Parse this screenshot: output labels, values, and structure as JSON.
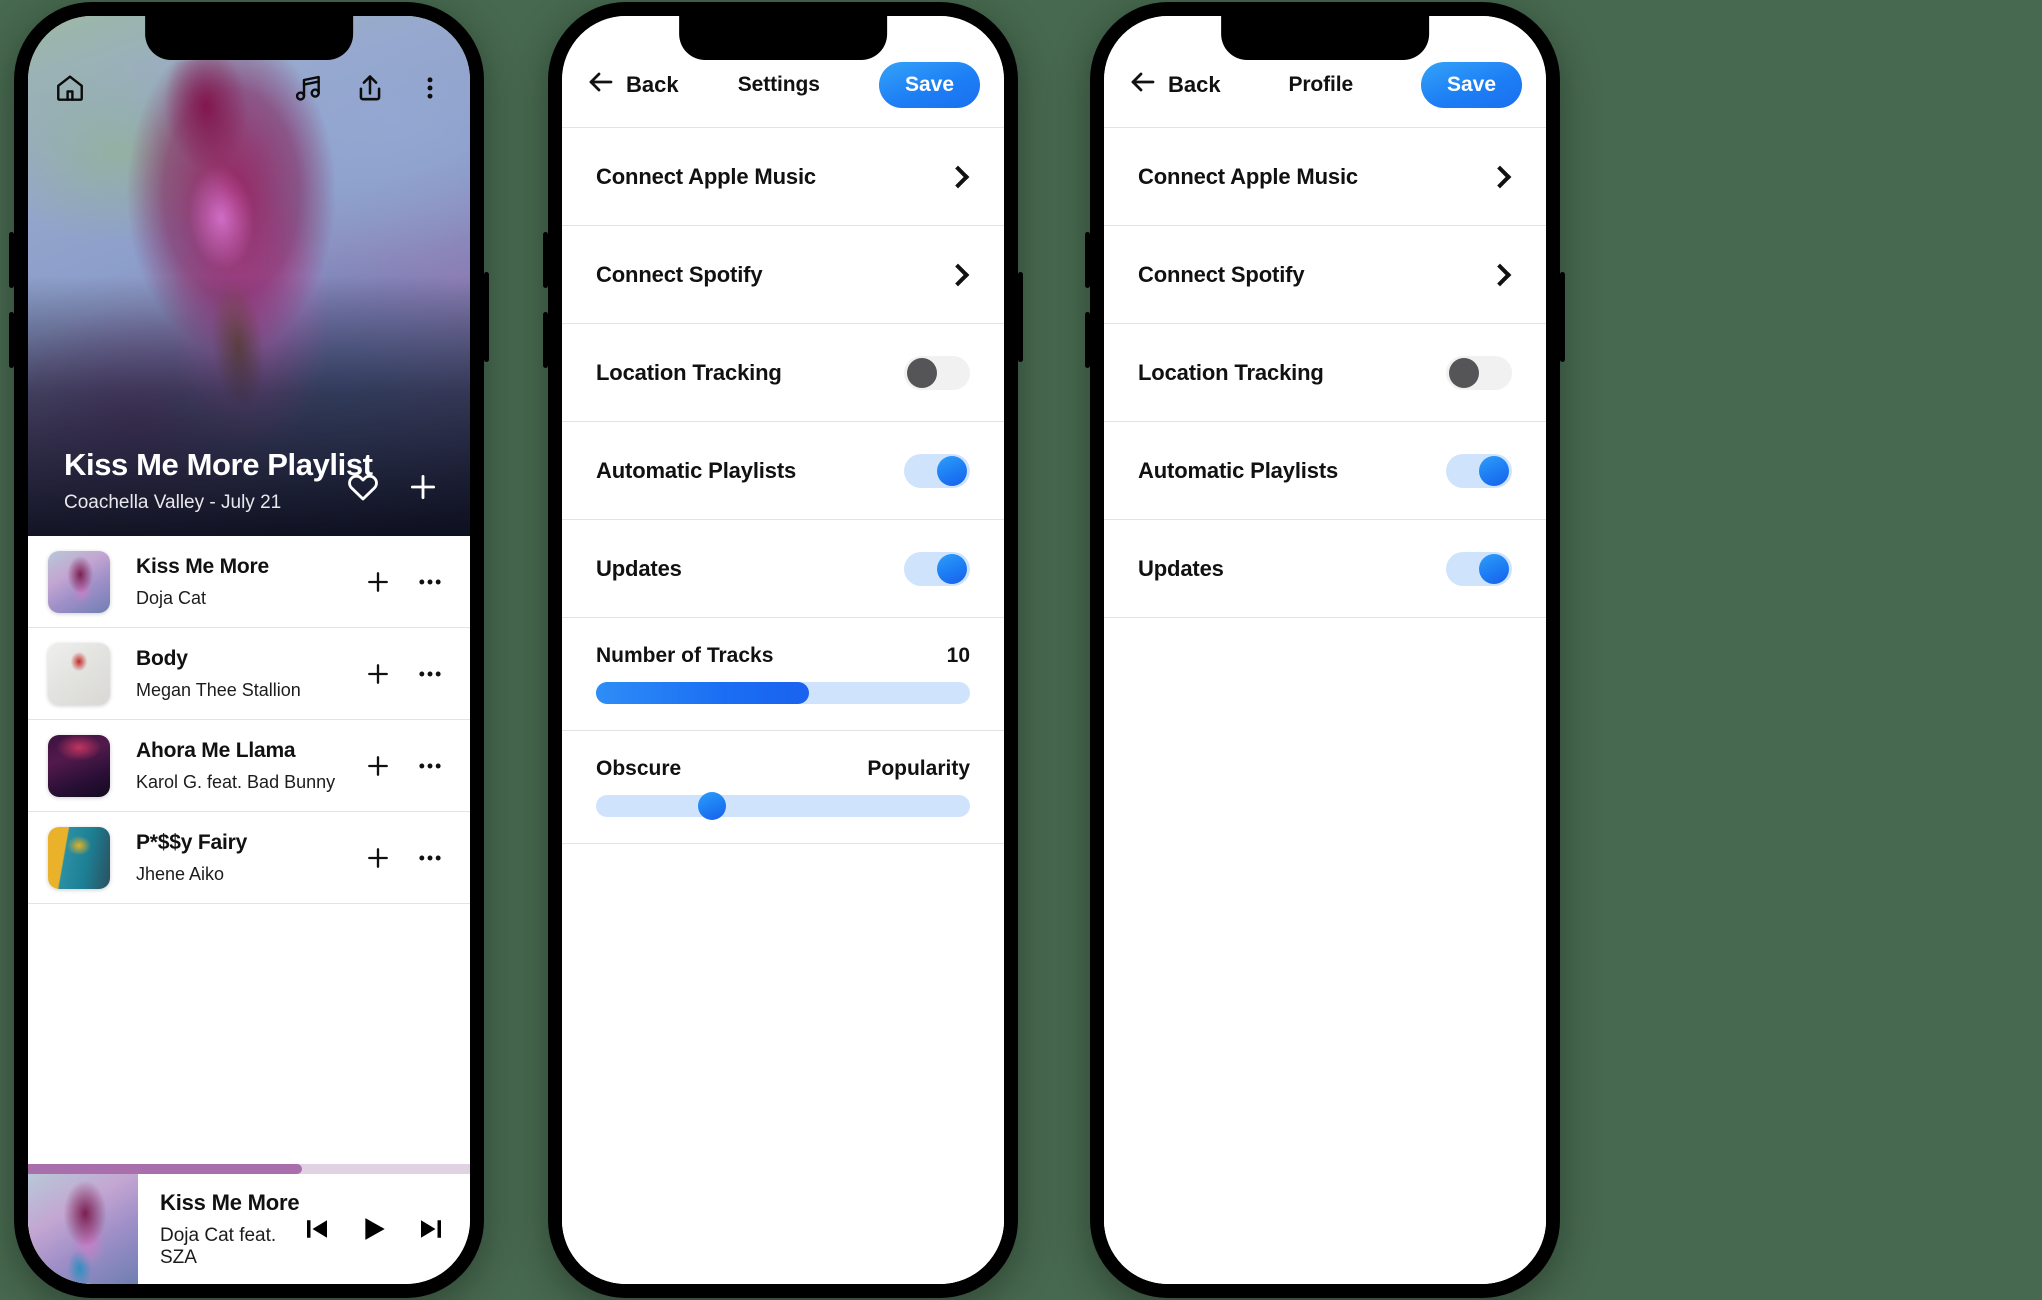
{
  "playlist_screen": {
    "topbar": {
      "home_icon": "home-icon",
      "music_icon": "music-note-icon",
      "share_icon": "share-upload-icon",
      "more_icon": "more-vertical-icon"
    },
    "hero": {
      "title": "Kiss Me More Playlist",
      "subtitle": "Coachella Valley - July 21",
      "like_icon": "heart-icon",
      "add_icon": "plus-icon"
    },
    "tracks": [
      {
        "title": "Kiss Me More",
        "artist": "Doja Cat"
      },
      {
        "title": "Body",
        "artist": "Megan Thee Stallion"
      },
      {
        "title": "Ahora Me Llama",
        "artist": "Karol G. feat. Bad Bunny"
      },
      {
        "title": "P*$$y Fairy",
        "artist": "Jhene Aiko"
      }
    ],
    "row_actions": {
      "add_icon": "plus-icon",
      "more_icon": "more-horizontal-icon"
    },
    "now_playing": {
      "title": "Kiss Me More",
      "artist": "Doja Cat feat. SZA",
      "progress_percent": 62,
      "progress_color": "#a86fac",
      "prev_icon": "skip-previous-icon",
      "play_icon": "play-icon",
      "next_icon": "skip-next-icon"
    }
  },
  "settings_screen": {
    "header": {
      "back_label": "Back",
      "back_icon": "arrow-left-icon",
      "title": "Settings",
      "save_label": "Save",
      "save_color": "#1d7ff5"
    },
    "rows": [
      {
        "label": "Connect Apple Music",
        "control": "chevron"
      },
      {
        "label": "Connect Spotify",
        "control": "chevron"
      },
      {
        "label": "Location Tracking",
        "control": "toggle",
        "value": "off"
      },
      {
        "label": "Automatic Playlists",
        "control": "toggle",
        "value": "on"
      },
      {
        "label": "Updates",
        "control": "toggle",
        "value": "on"
      }
    ],
    "track_slider": {
      "label": "Number of Tracks",
      "value": "10",
      "fill_percent": 57
    },
    "popularity_slider": {
      "left_label": "Obscure",
      "right_label": "Popularity",
      "thumb_percent": 31
    }
  },
  "profile_screen": {
    "header": {
      "back_label": "Back",
      "back_icon": "arrow-left-icon",
      "title": "Profile",
      "save_label": "Save",
      "save_color": "#1d7ff5"
    },
    "rows": [
      {
        "label": "Connect Apple Music",
        "control": "chevron"
      },
      {
        "label": "Connect Spotify",
        "control": "chevron"
      },
      {
        "label": "Location Tracking",
        "control": "toggle",
        "value": "off"
      },
      {
        "label": "Automatic Playlists",
        "control": "toggle",
        "value": "on"
      },
      {
        "label": "Updates",
        "control": "toggle",
        "value": "on"
      }
    ]
  }
}
